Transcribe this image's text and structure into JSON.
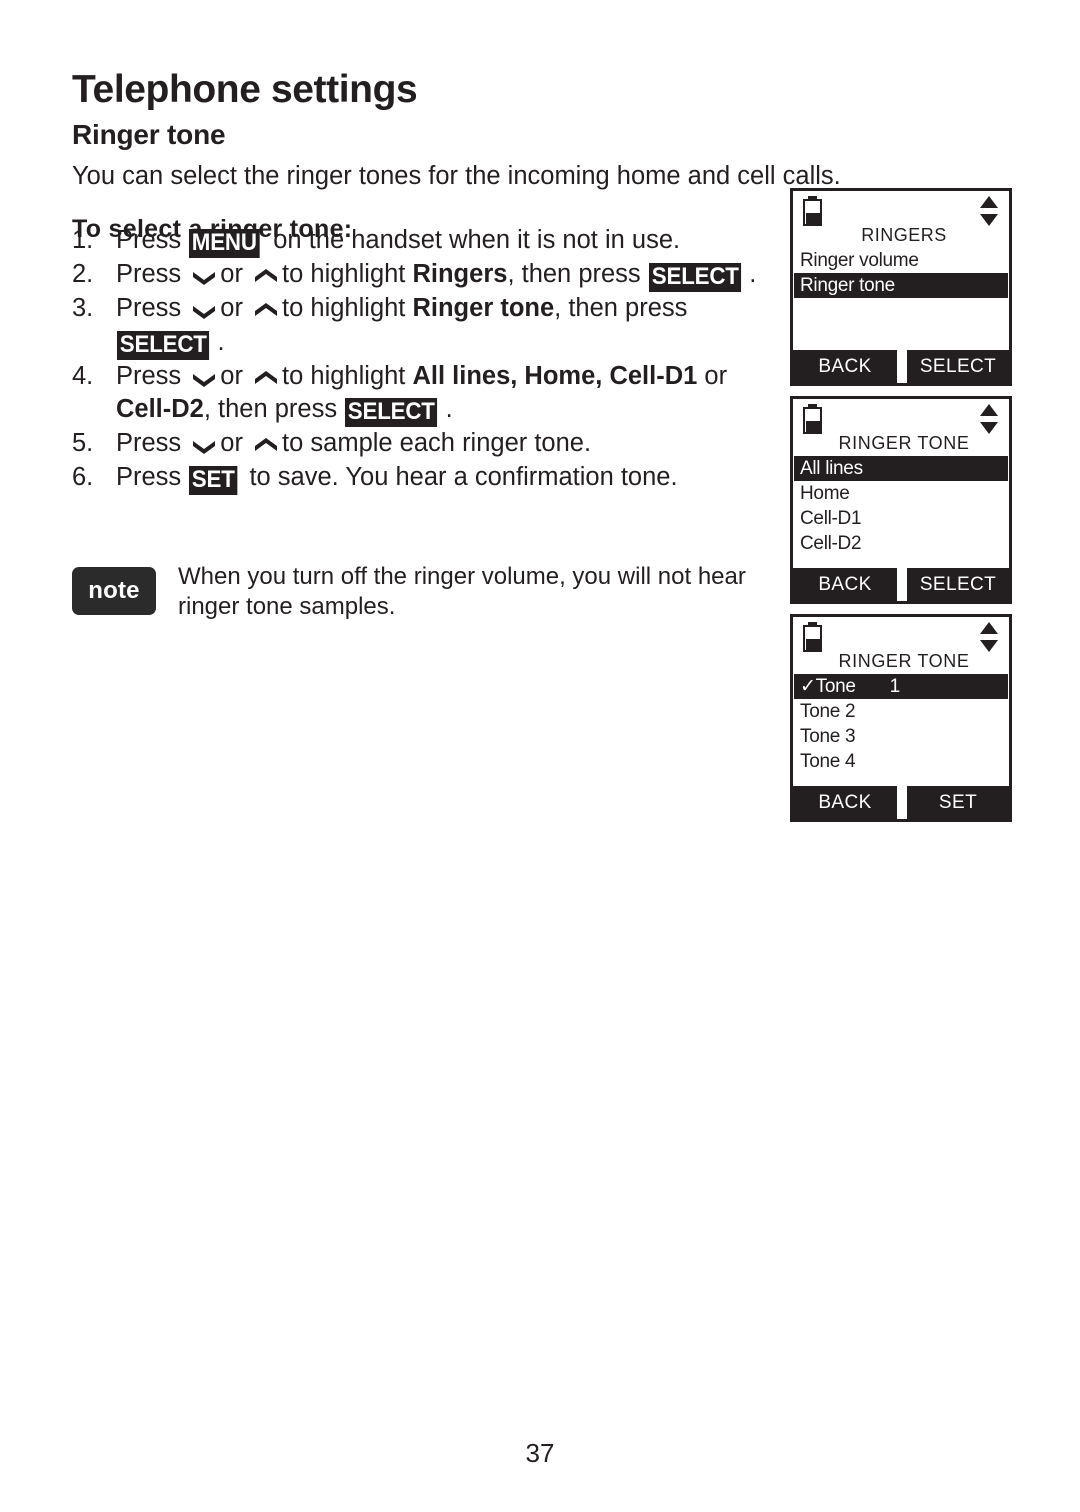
{
  "page": {
    "chapter_title": "Telephone settings",
    "section_title": "Ringer tone",
    "intro": "You can select the ringer tones for the incoming home and cell calls.",
    "subhead": "To select a ringer tone:",
    "page_number": "37"
  },
  "steps": [
    {
      "num": "1.",
      "parts": [
        {
          "t": "text",
          "v": "Press "
        },
        {
          "t": "key",
          "v": "MENU"
        },
        {
          "t": "text",
          "v": " on the handset when it is not in use."
        }
      ]
    },
    {
      "num": "2.",
      "parts": [
        {
          "t": "text",
          "v": "Press "
        },
        {
          "t": "icon",
          "v": "chevron-down-icon"
        },
        {
          "t": "text",
          "v": "or "
        },
        {
          "t": "icon",
          "v": "chevron-up-icon"
        },
        {
          "t": "text",
          "v": "to highlight "
        },
        {
          "t": "bold",
          "v": "Ringers"
        },
        {
          "t": "text",
          "v": ", then press "
        },
        {
          "t": "key",
          "v": "SELECT"
        },
        {
          "t": "text",
          "v": "."
        }
      ]
    },
    {
      "num": "3.",
      "parts": [
        {
          "t": "text",
          "v": "Press "
        },
        {
          "t": "icon",
          "v": "chevron-down-icon"
        },
        {
          "t": "text",
          "v": "or "
        },
        {
          "t": "icon",
          "v": "chevron-up-icon"
        },
        {
          "t": "text",
          "v": "to highlight "
        },
        {
          "t": "bold",
          "v": "Ringer tone"
        },
        {
          "t": "text",
          "v": ", then press "
        },
        {
          "t": "key",
          "v": "SELECT"
        },
        {
          "t": "text",
          "v": "."
        }
      ]
    },
    {
      "num": "4.",
      "parts": [
        {
          "t": "text",
          "v": "Press "
        },
        {
          "t": "icon",
          "v": "chevron-down-icon"
        },
        {
          "t": "text",
          "v": "or "
        },
        {
          "t": "icon",
          "v": "chevron-up-icon"
        },
        {
          "t": "text",
          "v": "to highlight "
        },
        {
          "t": "bold",
          "v": "All lines, Home, Cell-D1"
        },
        {
          "t": "text",
          "v": " or "
        },
        {
          "t": "bold",
          "v": "Cell-D2"
        },
        {
          "t": "text",
          "v": ", then press "
        },
        {
          "t": "key",
          "v": "SELECT"
        },
        {
          "t": "text",
          "v": "."
        }
      ]
    },
    {
      "num": "5.",
      "parts": [
        {
          "t": "text",
          "v": "Press "
        },
        {
          "t": "icon",
          "v": "chevron-down-icon"
        },
        {
          "t": "text",
          "v": "or "
        },
        {
          "t": "icon",
          "v": "chevron-up-icon"
        },
        {
          "t": "text",
          "v": "to sample each ringer tone."
        }
      ]
    },
    {
      "num": "6.",
      "parts": [
        {
          "t": "text",
          "v": "Press "
        },
        {
          "t": "key",
          "v": "SET"
        },
        {
          "t": "text",
          "v": " to save. You hear a confirmation tone."
        }
      ]
    }
  ],
  "note": {
    "badge_label": "note",
    "text": "When you turn off the ringer volume, you will not hear ringer tone samples."
  },
  "screens": [
    {
      "title": "RINGERS",
      "status_icons": [
        "battery-icon",
        "scroll-arrows-icon"
      ],
      "rows": [
        {
          "label": "Ringer volume",
          "selected": false,
          "checked": false
        },
        {
          "label": "Ringer tone",
          "selected": true,
          "checked": false
        }
      ],
      "softkey_left": "BACK",
      "softkey_right": "SELECT"
    },
    {
      "title": "RINGER TONE",
      "status_icons": [
        "battery-icon",
        "scroll-arrows-icon"
      ],
      "rows": [
        {
          "label": "All lines",
          "selected": true,
          "checked": false
        },
        {
          "label": "Home",
          "selected": false,
          "checked": false
        },
        {
          "label": "Cell-D1",
          "selected": false,
          "checked": false
        },
        {
          "label": "Cell-D2",
          "selected": false,
          "checked": false
        }
      ],
      "softkey_left": "BACK",
      "softkey_right": "SELECT"
    },
    {
      "title": "RINGER TONE",
      "status_icons": [
        "battery-icon",
        "scroll-arrows-icon"
      ],
      "rows": [
        {
          "label": "Tone",
          "value": "1",
          "selected": true,
          "checked": true
        },
        {
          "label": "Tone 2",
          "selected": false,
          "checked": false
        },
        {
          "label": "Tone 3",
          "selected": false,
          "checked": false
        },
        {
          "label": "Tone 4",
          "selected": false,
          "checked": false
        }
      ],
      "softkey_left": "BACK",
      "softkey_right": "SET"
    }
  ],
  "colors": {
    "ink": "#231f20",
    "paper": "#ffffff",
    "note_badge": "#2b2b2b"
  }
}
